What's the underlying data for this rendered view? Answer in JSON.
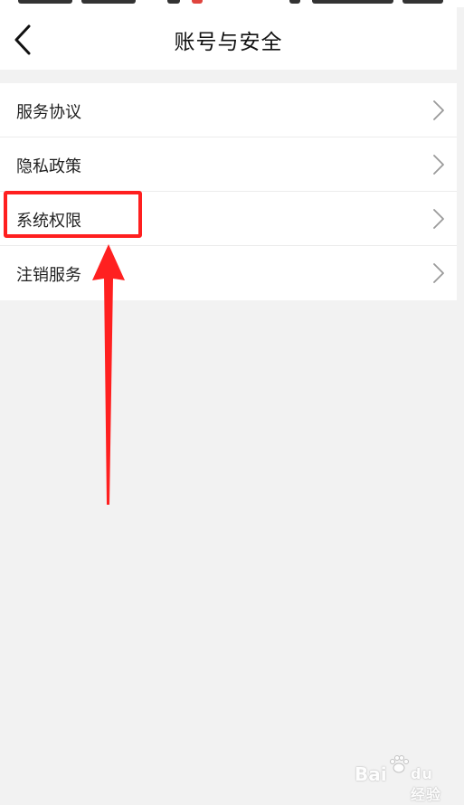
{
  "header": {
    "title": "账号与安全",
    "back_icon": "chevron-left-icon"
  },
  "menu": {
    "items": [
      {
        "label": "服务协议",
        "icon": "chevron-right-icon"
      },
      {
        "label": "隐私政策",
        "icon": "chevron-right-icon"
      },
      {
        "label": "系统权限",
        "icon": "chevron-right-icon"
      },
      {
        "label": "注销服务",
        "icon": "chevron-right-icon"
      }
    ]
  },
  "annotation": {
    "highlight_color": "#ff1f1f",
    "highlighted_item": "系统权限"
  },
  "colors": {
    "background": "#f2f2f2",
    "card": "#ffffff",
    "text": "#222222",
    "chevron": "#9a9a9a"
  },
  "watermark": {
    "brand": "Bai",
    "brand_suffix": "du",
    "sub": "经验"
  }
}
